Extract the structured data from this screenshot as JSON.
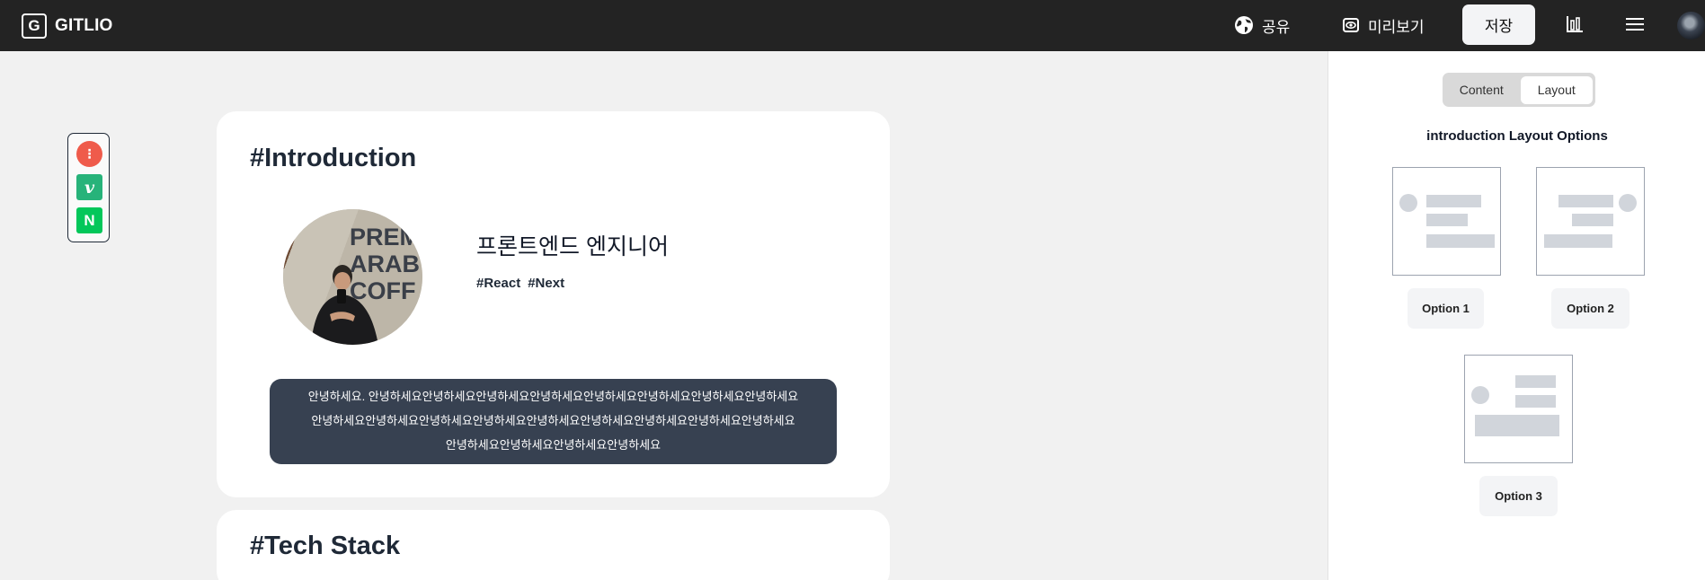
{
  "brand": {
    "mark": "G",
    "name": "GITLIO"
  },
  "nav": {
    "share_label": "공유",
    "preview_label": "미리보기",
    "save_label": "저장",
    "icons": [
      "globe-icon",
      "eye-icon",
      "bar-chart-icon",
      "menu-icon",
      "avatar"
    ]
  },
  "panel": {
    "tabs": [
      "Content",
      "Layout"
    ],
    "active_tab": "Layout",
    "title": "introduction Layout Options",
    "options": [
      "Option 1",
      "Option 2",
      "Option 3"
    ]
  },
  "social": {
    "items": [
      {
        "icon": "tistory-icon",
        "glyph": "⋮",
        "color": "#ef5b4b"
      },
      {
        "icon": "velog-icon",
        "glyph": "v",
        "color": "#27b37a"
      },
      {
        "icon": "naver-icon",
        "glyph": "N",
        "color": "#03c75a"
      }
    ]
  },
  "intro": {
    "title": "#Introduction",
    "job": "프론트엔드 엔지니어",
    "tags": [
      "#React",
      "#Next"
    ],
    "bio_lines": [
      "안녕하세요. 안녕하세요안녕하세요안녕하세요안녕하세요안녕하세요안녕하세요안녕하세요안녕하세요",
      "안녕하세요안녕하세요안녕하세요안녕하세요안녕하세요안녕하세요안녕하세요안녕하세요안녕하세요",
      "안녕하세요안녕하세요안녕하세요안녕하세요"
    ]
  },
  "tech": {
    "title": "#Tech Stack"
  }
}
